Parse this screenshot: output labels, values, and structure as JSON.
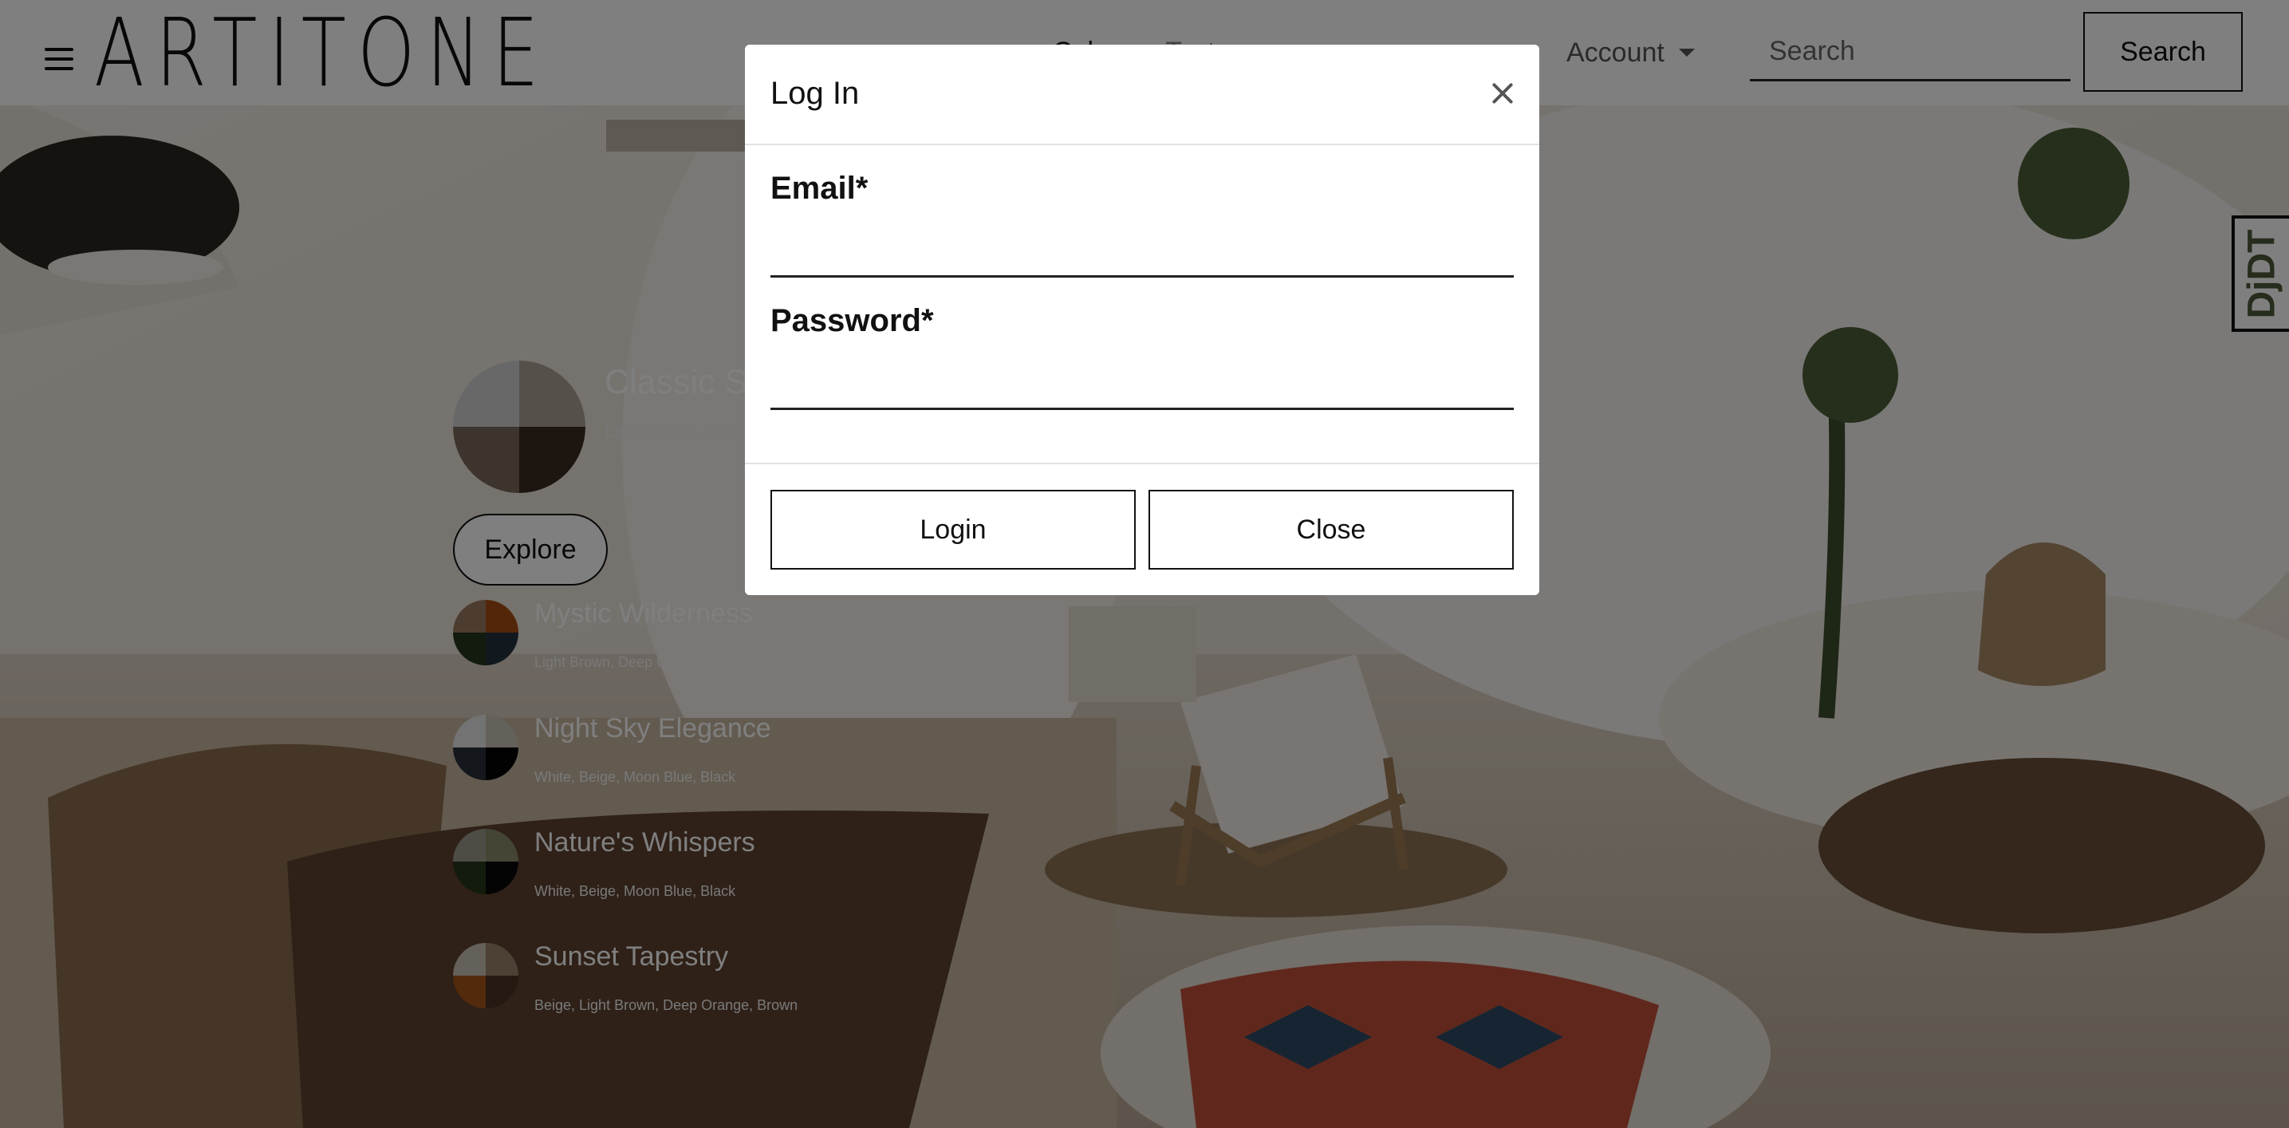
{
  "navbar": {
    "logo_text": "ARTITONE",
    "links": [
      "Color",
      "Texture"
    ],
    "account_label": "Account",
    "search_placeholder": "Search",
    "search_button_label": "Search"
  },
  "debug_toolbar": {
    "label": "DjDT"
  },
  "featured_palette": {
    "name": "Classic Si",
    "colors": "Light Brown, Dee",
    "swatch": [
      "#d0d0d0",
      "#aaa095",
      "#7a6a5a",
      "#3a2b20"
    ]
  },
  "explore_button_label": "Explore",
  "palettes": [
    {
      "name": "Mystic Wilderness",
      "colors": "Light Brown, Deep Orange, Jungle green, M",
      "swatch": [
        "#9b7a60",
        "#a94c12",
        "#25361a",
        "#25323d"
      ]
    },
    {
      "name": "Night Sky Elegance",
      "colors": "White, Beige, Moon Blue, Black",
      "swatch": [
        "#e6e6e6",
        "#c8c0b4",
        "#28303a",
        "#050505"
      ]
    },
    {
      "name": "Nature's Whispers",
      "colors": "White, Beige, Moon Blue, Black",
      "swatch": [
        "#9a9a8c",
        "#8a8a6a",
        "#26361a",
        "#080808"
      ]
    },
    {
      "name": "Sunset Tapestry",
      "colors": "Beige, Light Brown, Deep Orange, Brown",
      "swatch": [
        "#c8c0b4",
        "#9b8068",
        "#a9541a",
        "#4a3222"
      ]
    }
  ],
  "modal": {
    "title": "Log In",
    "email_label": "Email*",
    "password_label": "Password*",
    "login_button_label": "Login",
    "close_button_label": "Close"
  }
}
